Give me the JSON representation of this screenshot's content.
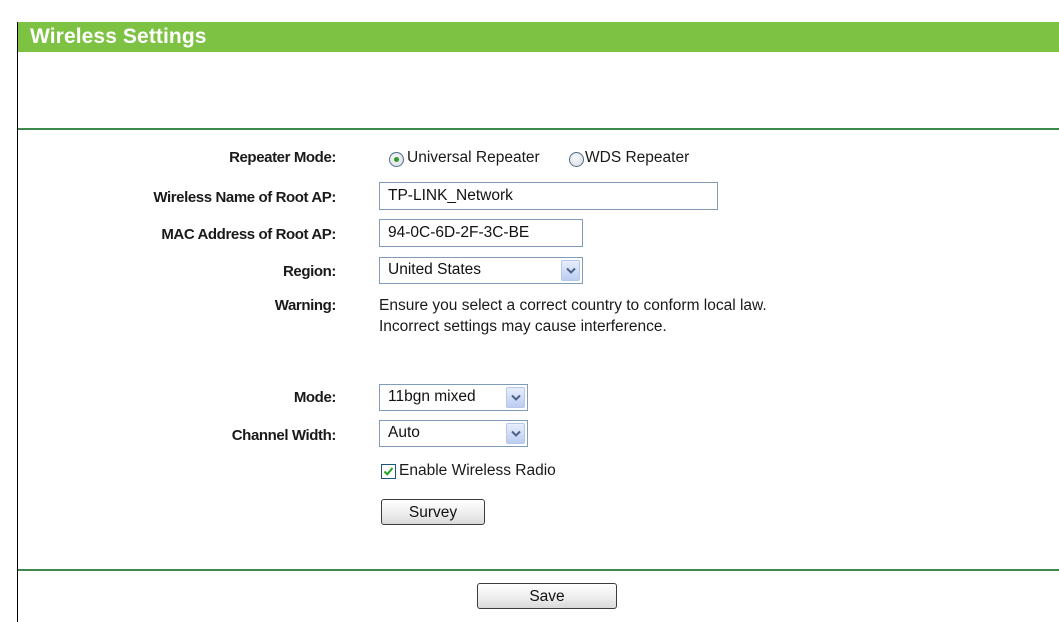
{
  "header": {
    "title": "Wireless Settings"
  },
  "form": {
    "repeater_mode": {
      "label": "Repeater Mode:",
      "options": [
        "Universal Repeater",
        "WDS Repeater"
      ],
      "selected": "Universal Repeater"
    },
    "root_ap_name": {
      "label": "Wireless Name of Root AP:",
      "value": "TP-LINK_Network"
    },
    "root_ap_mac": {
      "label": "MAC Address of Root AP:",
      "value": "94-0C-6D-2F-3C-BE"
    },
    "region": {
      "label": "Region:",
      "value": "United States"
    },
    "warning": {
      "label": "Warning:",
      "line1": "Ensure you select a correct country to conform local law.",
      "line2": "Incorrect settings may cause interference."
    },
    "mode": {
      "label": "Mode:",
      "value": "11bgn mixed"
    },
    "channel_width": {
      "label": "Channel Width:",
      "value": "Auto"
    },
    "enable_radio": {
      "label": "Enable Wireless Radio",
      "checked": true
    },
    "survey_button": "Survey",
    "save_button": "Save"
  },
  "colors": {
    "header_bar": "#7dc242",
    "rule": "#3c8a4c",
    "header_text": "#ffffff"
  },
  "icons": {
    "select_arrow": "chevron-down-icon",
    "checkbox_check": "checkmark-icon",
    "radio_selected": "radio-dot-icon"
  }
}
